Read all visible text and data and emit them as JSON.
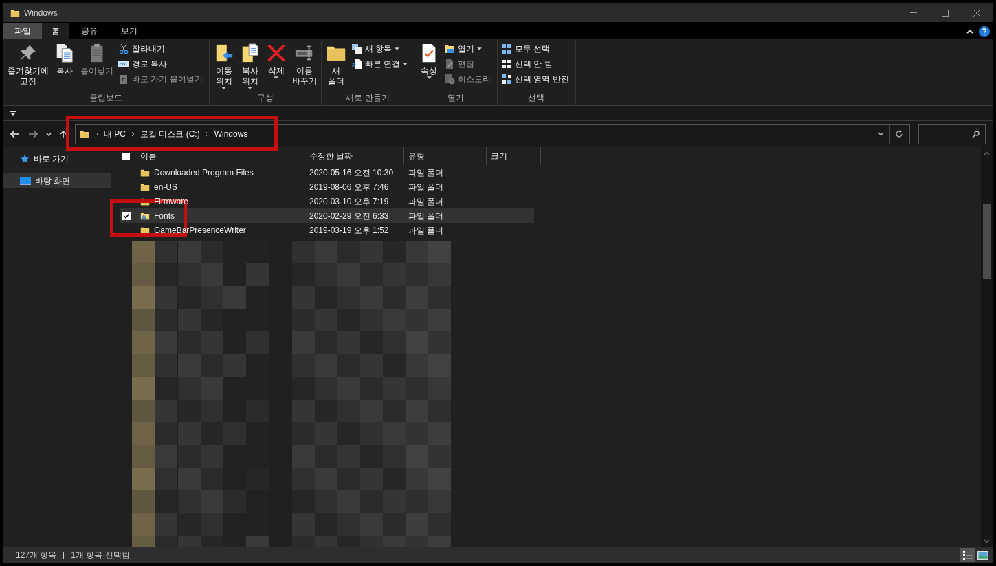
{
  "window": {
    "title": "Windows"
  },
  "ribbon": {
    "tabs": [
      {
        "label": "파일",
        "kind": "file",
        "selected": false
      },
      {
        "label": "홈",
        "kind": "tab",
        "selected": true
      },
      {
        "label": "공유",
        "kind": "tab",
        "selected": false
      },
      {
        "label": "보기",
        "kind": "tab",
        "selected": false
      }
    ],
    "groups": [
      {
        "label": "클립보드",
        "items": [
          {
            "kind": "large",
            "label": "즐겨찾기에\n고정",
            "disabled": false,
            "menu": false
          },
          {
            "kind": "large",
            "label": "복사",
            "disabled": false,
            "menu": false
          },
          {
            "kind": "large",
            "label": "붙여넣기",
            "disabled": true,
            "menu": false
          },
          {
            "kind": "small",
            "label": "잘라내기",
            "disabled": false,
            "menu": false
          },
          {
            "kind": "small",
            "label": "경로 복사",
            "disabled": false,
            "menu": false
          },
          {
            "kind": "small",
            "label": "바로 가기 붙여넣기",
            "disabled": true,
            "menu": false
          }
        ]
      },
      {
        "label": "구성",
        "items": [
          {
            "kind": "large",
            "label": "이동\n위치",
            "disabled": false,
            "menu": true
          },
          {
            "kind": "large",
            "label": "복사\n위치",
            "disabled": false,
            "menu": true
          },
          {
            "kind": "large",
            "label": "삭제",
            "disabled": false,
            "menu": true
          },
          {
            "kind": "large",
            "label": "이름\n바꾸기",
            "disabled": false,
            "menu": false
          }
        ]
      },
      {
        "label": "새로 만들기",
        "items": [
          {
            "kind": "large",
            "label": "새\n폴더",
            "disabled": false,
            "menu": false
          },
          {
            "kind": "small",
            "label": "새 항목",
            "disabled": false,
            "menu": true
          },
          {
            "kind": "small",
            "label": "빠른 연결",
            "disabled": false,
            "menu": true
          }
        ]
      },
      {
        "label": "열기",
        "items": [
          {
            "kind": "large",
            "label": "속성",
            "disabled": false,
            "menu": true
          },
          {
            "kind": "small",
            "label": "열기",
            "disabled": false,
            "menu": true
          },
          {
            "kind": "small",
            "label": "편집",
            "disabled": true,
            "menu": false
          },
          {
            "kind": "small",
            "label": "히스토리",
            "disabled": true,
            "menu": false
          }
        ]
      },
      {
        "label": "선택",
        "items": [
          {
            "kind": "small",
            "label": "모두 선택",
            "disabled": false,
            "menu": false
          },
          {
            "kind": "small",
            "label": "선택 안 함",
            "disabled": false,
            "menu": false
          },
          {
            "kind": "small",
            "label": "선택 영역 반전",
            "disabled": false,
            "menu": false
          }
        ]
      }
    ]
  },
  "address": {
    "crumbs": [
      "내 PC",
      "로컬 디스크 (C:)",
      "Windows"
    ]
  },
  "sidebar": {
    "items": [
      {
        "label": "바로 가기",
        "kind": "star",
        "selected": false
      },
      {
        "label": "바탕 화면",
        "kind": "desktop",
        "selected": true
      }
    ]
  },
  "table": {
    "select_all_checked": false,
    "columns": [
      "이름",
      "수정한 날짜",
      "유형",
      "크기"
    ],
    "rows": [
      {
        "name": "Downloaded Program Files",
        "date": "2020-05-16 오전 10:30",
        "type": "파일 폴더",
        "kind": "folder",
        "selected": false
      },
      {
        "name": "en-US",
        "date": "2019-08-06 오후 7:46",
        "type": "파일 폴더",
        "kind": "folder",
        "selected": false
      },
      {
        "name": "Firmware",
        "date": "2020-03-10 오후 7:19",
        "type": "파일 폴더",
        "kind": "folder",
        "selected": false
      },
      {
        "name": "Fonts",
        "date": "2020-02-29 오전 6:33",
        "type": "파일 폴더",
        "kind": "fonts",
        "selected": true
      },
      {
        "name": "GameBarPresenceWriter",
        "date": "2019-03-19 오후 1:52",
        "type": "파일 폴더",
        "kind": "folder",
        "selected": false
      }
    ]
  },
  "status_bar": [
    "127개 항목",
    "1개 항목 선택함"
  ]
}
